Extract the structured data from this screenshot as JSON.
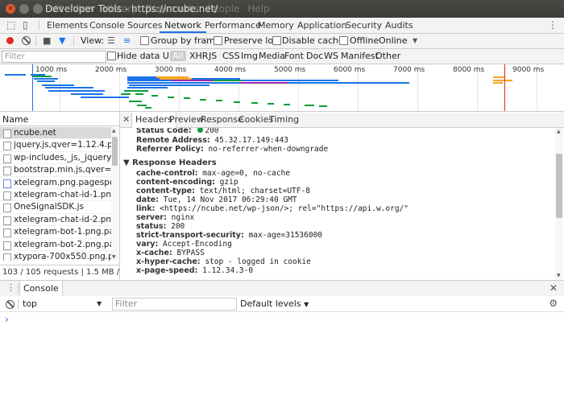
{
  "window": {
    "title": "Developer Tools - https://ncube.net/",
    "menus": [
      "Edit",
      "View",
      "History",
      "Bookmarks",
      "People",
      "Help"
    ]
  },
  "tabs": [
    "Elements",
    "Console",
    "Sources",
    "Network",
    "Performance",
    "Memory",
    "Application",
    "Security",
    "Audits"
  ],
  "active_tab": "Network",
  "toolbar": {
    "view_label": "View:",
    "group_by_frame": "Group by frame",
    "preserve_log": "Preserve log",
    "disable_cache": "Disable cache",
    "offline": "Offline",
    "throttle": "Online"
  },
  "filter": {
    "placeholder": "Filter",
    "hide_data_urls": "Hide data URLs",
    "types": [
      "All",
      "XHR",
      "JS",
      "CSS",
      "Img",
      "Media",
      "Font",
      "Doc",
      "WS",
      "Manifest",
      "Other"
    ],
    "active_type": "All"
  },
  "overview": {
    "ticks": [
      "1000 ms",
      "2000 ms",
      "3000 ms",
      "4000 ms",
      "5000 ms",
      "6000 ms",
      "7000 ms",
      "8000 ms",
      "9000 ms"
    ]
  },
  "requests": {
    "header": "Name",
    "items": [
      "ncube.net",
      "jquery.js,qver=1.12.4.pagesp...",
      "wp-includes,_js,_jquery,_jque...",
      "bootstrap.min.js,qver=4.8.3.p...",
      "xtelegram.png.pagespeed.ic...",
      "xtelegram-chat-id-1.png.pag...",
      "OneSignalSDK.js",
      "xtelegram-chat-id-2.png.pag...",
      "xtelegram-bot-1.png.pagesp...",
      "xtelegram-bot-2.png.pagesp...",
      "xtypora-700x550.png.pagesp..."
    ],
    "selected": 0,
    "status": "103 / 105 requests  |  1.5 MB / 1..."
  },
  "detail": {
    "tabs": [
      "Headers",
      "Preview",
      "Response",
      "Cookies",
      "Timing"
    ],
    "active_tab": "Headers",
    "general": [
      {
        "key": "Status Code:",
        "value": "200"
      },
      {
        "key": "Remote Address:",
        "value": "45.32.17.149:443"
      },
      {
        "key": "Referrer Policy:",
        "value": "no-referrer-when-downgrade"
      }
    ],
    "response_headers_title": "Response Headers",
    "response_headers": [
      {
        "key": "cache-control:",
        "value": "max-age=0, no-cache"
      },
      {
        "key": "content-encoding:",
        "value": "gzip"
      },
      {
        "key": "content-type:",
        "value": "text/html; charset=UTF-8"
      },
      {
        "key": "date:",
        "value": "Tue, 14 Nov 2017 06:29:40 GMT"
      },
      {
        "key": "link:",
        "value": "<https://ncube.net/wp-json/>; rel=\"https://api.w.org/\""
      },
      {
        "key": "server:",
        "value": "nginx"
      },
      {
        "key": "status:",
        "value": "200"
      },
      {
        "key": "strict-transport-security:",
        "value": "max-age=31536000"
      },
      {
        "key": "vary:",
        "value": "Accept-Encoding"
      },
      {
        "key": "x-cache:",
        "value": "BYPASS"
      },
      {
        "key": "x-hyper-cache:",
        "value": "stop - logged in cookie"
      },
      {
        "key": "x-page-speed:",
        "value": "1.12.34.3-0"
      }
    ]
  },
  "drawer": {
    "tab": "Console",
    "context": "top",
    "filter_placeholder": "Filter",
    "levels": "Default levels",
    "prompt": "›"
  },
  "colors": {
    "accent": "#1a73e8",
    "record": "#e0281e",
    "status_ok": "#0a9d3a"
  }
}
